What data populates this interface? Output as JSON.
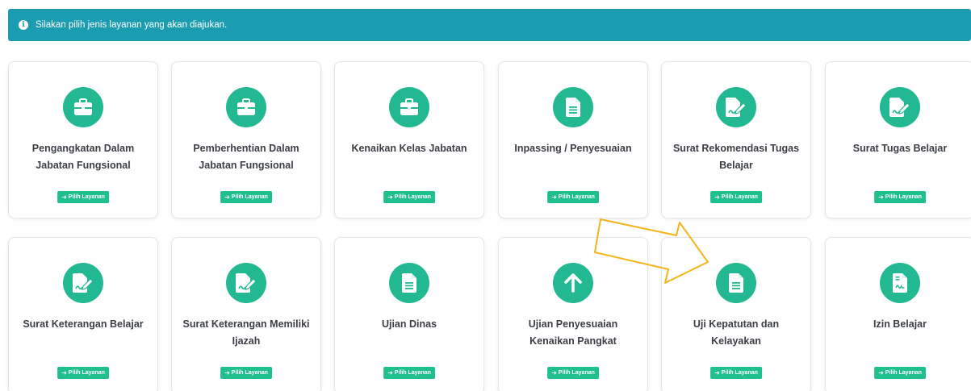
{
  "alert": {
    "icon": "info-icon",
    "text": "Silakan pilih jenis layanan yang akan diajukan."
  },
  "cards": [
    {
      "title": "Pengangkatan Dalam Jabatan Fungsional",
      "icon": "briefcase-icon",
      "button": "Pilih Layanan"
    },
    {
      "title": "Pemberhentian Dalam Jabatan Fungsional",
      "icon": "briefcase-icon",
      "button": "Pilih Layanan"
    },
    {
      "title": "Kenaikan Kelas Jabatan",
      "icon": "briefcase-icon",
      "button": "Pilih Layanan"
    },
    {
      "title": "Inpassing / Penyesuaian",
      "icon": "document-icon",
      "button": "Pilih Layanan"
    },
    {
      "title": "Surat Rekomendasi Tugas Belajar",
      "icon": "signature-edit-icon",
      "button": "Pilih Layanan"
    },
    {
      "title": "Surat Tugas Belajar",
      "icon": "signature-edit-icon",
      "button": "Pilih Layanan"
    },
    {
      "title": "Surat Keterangan Belajar",
      "icon": "signature-edit-icon",
      "button": "Pilih Layanan"
    },
    {
      "title": "Surat Keterangan Memiliki Ijazah",
      "icon": "signature-edit-icon",
      "button": "Pilih Layanan"
    },
    {
      "title": "Ujian Dinas",
      "icon": "document-icon",
      "button": "Pilih Layanan"
    },
    {
      "title": "Ujian Penyesuaian Kenaikan Pangkat",
      "icon": "arrow-up-icon",
      "button": "Pilih Layanan"
    },
    {
      "title": "Uji Kepatutan dan Kelayakan",
      "icon": "document-icon",
      "button": "Pilih Layanan"
    },
    {
      "title": "Izin Belajar",
      "icon": "signed-document-icon",
      "button": "Pilih Layanan"
    }
  ],
  "colors": {
    "alert_bg": "#1b9cb1",
    "icon_circle": "#21b892",
    "button_bg": "#1fc08e",
    "annotation_arrow": "#f3b51b"
  }
}
